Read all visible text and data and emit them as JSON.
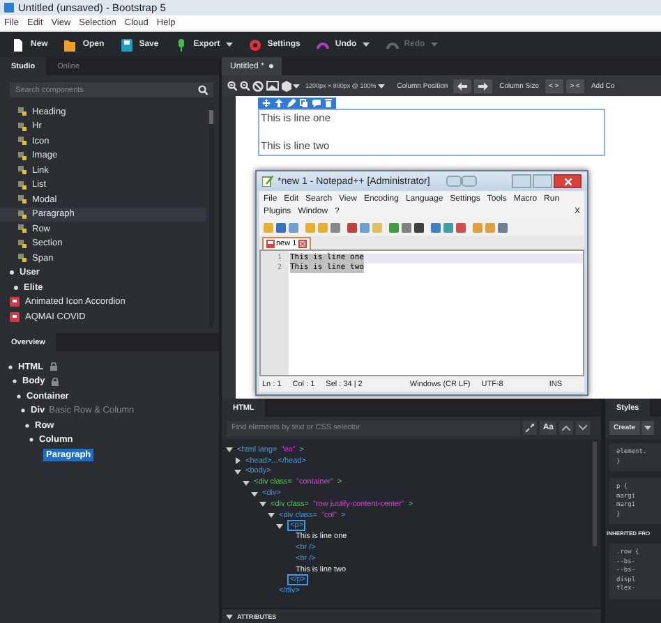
{
  "window": {
    "title": "Untitled (unsaved) - Bootstrap 5"
  },
  "menu": [
    "File",
    "Edit",
    "View",
    "Selection",
    "Cloud",
    "Help"
  ],
  "toolbar": [
    {
      "label": "New",
      "kind": "page",
      "dropdown": false,
      "disabled": false
    },
    {
      "label": "Open",
      "kind": "folder",
      "dropdown": false,
      "disabled": false
    },
    {
      "label": "Save",
      "kind": "disk",
      "dropdown": false,
      "disabled": false
    },
    {
      "label": "Export",
      "kind": "export",
      "dropdown": true,
      "disabled": false
    },
    {
      "label": "Settings",
      "kind": "gear",
      "dropdown": false,
      "disabled": false
    },
    {
      "label": "Undo",
      "kind": "undo",
      "dropdown": true,
      "disabled": false
    },
    {
      "label": "Redo",
      "kind": "redo",
      "dropdown": true,
      "disabled": true
    }
  ],
  "left_tabs": [
    {
      "label": "Studio",
      "selected": true
    },
    {
      "label": "Online",
      "selected": false
    }
  ],
  "components_search": {
    "placeholder": "Search components"
  },
  "components": [
    {
      "label": "Heading",
      "kind": "component",
      "selected": false
    },
    {
      "label": "Hr",
      "kind": "component",
      "selected": false
    },
    {
      "label": "Icon",
      "kind": "component",
      "selected": false
    },
    {
      "label": "Image",
      "kind": "component",
      "selected": false
    },
    {
      "label": "Link",
      "kind": "component",
      "selected": false
    },
    {
      "label": "List",
      "kind": "component",
      "selected": false
    },
    {
      "label": "Modal",
      "kind": "component",
      "selected": false
    },
    {
      "label": "Paragraph",
      "kind": "component",
      "selected": true
    },
    {
      "label": "Row",
      "kind": "component",
      "selected": false
    },
    {
      "label": "Section",
      "kind": "component",
      "selected": false
    },
    {
      "label": "Span",
      "kind": "component",
      "selected": false
    },
    {
      "label": "User",
      "kind": "group",
      "selected": false
    },
    {
      "label": "Elite",
      "kind": "subgroup",
      "selected": false
    },
    {
      "label": "Animated Icon Accordion",
      "kind": "package",
      "selected": false
    },
    {
      "label": "AQMAI COVID",
      "kind": "package",
      "selected": false
    }
  ],
  "overview_tab": {
    "label": "Overview",
    "selected": true
  },
  "overview_tree": [
    {
      "label": "HTML",
      "locked": true,
      "selected": false,
      "children": [
        {
          "label": "Body",
          "locked": true,
          "selected": false,
          "children": [
            {
              "label": "Container",
              "locked": false,
              "selected": false,
              "children": [
                {
                  "label": "Div",
                  "note": "Basic Row & Column",
                  "locked": false,
                  "selected": false,
                  "children": [
                    {
                      "label": "Row",
                      "locked": false,
                      "selected": false,
                      "children": [
                        {
                          "label": "Column",
                          "locked": false,
                          "selected": false,
                          "children": [
                            {
                              "label": "Paragraph",
                              "locked": false,
                              "selected": true
                            }
                          ]
                        }
                      ]
                    }
                  ]
                }
              ]
            }
          ]
        }
      ]
    }
  ],
  "doc_tab": {
    "label": "Untitled *",
    "selected": true
  },
  "canvas_toolbar": {
    "size": "1200px × 800px @ 100%",
    "column_position": "Column Position",
    "column_size": "Column Size",
    "size_buttons": [
      "< >",
      "> <"
    ],
    "add": "Add Co"
  },
  "canvas": {
    "lines": [
      "This is line one",
      "This is line two"
    ]
  },
  "notepad": {
    "title": "*new 1 - Notepad++ [Administrator]",
    "menu_rows": [
      [
        "File",
        "Edit",
        "Search",
        "View",
        "Encoding",
        "Language",
        "Settings",
        "Tools",
        "Macro",
        "Run"
      ],
      [
        "Plugins",
        "Window",
        "?"
      ]
    ],
    "close_doc": "X",
    "tab": "new 1",
    "lines": [
      {
        "number": "1",
        "text": "This is line one",
        "current": true,
        "selected": true
      },
      {
        "number": "2",
        "text": "This is line two",
        "current": false,
        "selected": true
      }
    ],
    "status": [
      "Ln : 1",
      "Col : 1",
      "Sel : 34 | 2",
      "Windows (CR LF)",
      "UTF-8",
      "INS"
    ]
  },
  "html_panel": {
    "tab": "HTML",
    "search_placeholder": "Find elements by text or CSS selector",
    "case_button": "Aa",
    "tree": [
      {
        "parts": [
          {
            "kind": "tag",
            "text": "<html lang="
          },
          {
            "kind": "value",
            "text": "\"en\""
          },
          {
            "kind": "tag",
            "text": ">"
          }
        ],
        "expanded": true,
        "selected": false,
        "children": [
          {
            "parts": [
              {
                "kind": "tag",
                "text": "<head>...</head>"
              }
            ],
            "expanded": false,
            "selected": false
          },
          {
            "parts": [
              {
                "kind": "tag",
                "text": "<body>"
              }
            ],
            "expanded": true,
            "selected": false,
            "children": [
              {
                "parts": [
                  {
                    "kind": "attr",
                    "text": "<div class="
                  },
                  {
                    "kind": "value",
                    "text": "\"container\""
                  },
                  {
                    "kind": "attr",
                    "text": ">"
                  }
                ],
                "expanded": true,
                "selected": false,
                "children": [
                  {
                    "parts": [
                      {
                        "kind": "tag",
                        "text": "<div>"
                      }
                    ],
                    "expanded": true,
                    "selected": false,
                    "children": [
                      {
                        "parts": [
                          {
                            "kind": "attr",
                            "text": "<div class="
                          },
                          {
                            "kind": "value",
                            "text": "\"row justify-content-center\""
                          },
                          {
                            "kind": "attr",
                            "text": ">"
                          }
                        ],
                        "expanded": true,
                        "selected": false,
                        "children": [
                          {
                            "parts": [
                              {
                                "kind": "tag",
                                "text": "<div class="
                              },
                              {
                                "kind": "value",
                                "text": "\"col\""
                              },
                              {
                                "kind": "tag",
                                "text": ">"
                              }
                            ],
                            "expanded": true,
                            "selected": false,
                            "close": "</div>",
                            "children": [
                              {
                                "parts": [
                                  {
                                    "kind": "tag",
                                    "text": "<p>"
                                  }
                                ],
                                "expanded": true,
                                "selected": true,
                                "close": "</p>",
                                "children": [
                                  {
                                    "parts": [
                                      {
                                        "kind": "text",
                                        "text": "This is line one"
                                      }
                                    ]
                                  },
                                  {
                                    "parts": [
                                      {
                                        "kind": "tag",
                                        "text": "<br />"
                                      }
                                    ]
                                  },
                                  {
                                    "parts": [
                                      {
                                        "kind": "tag",
                                        "text": "<br />"
                                      }
                                    ]
                                  },
                                  {
                                    "parts": [
                                      {
                                        "kind": "text",
                                        "text": "This is line two"
                                      }
                                    ]
                                  }
                                ]
                              }
                            ]
                          }
                        ]
                      }
                    ]
                  }
                ]
              }
            ]
          }
        ]
      }
    ],
    "attributes": {
      "label": "ATTRIBUTES",
      "expanded": true
    }
  },
  "styles_panel": {
    "tab": "Styles",
    "create": "Create",
    "blocks": [
      {
        "kind": "rule",
        "lines": [
          "element.",
          "}"
        ]
      },
      {
        "kind": "rule",
        "lines": [
          "p {",
          "margi",
          "margi",
          "}"
        ]
      },
      {
        "kind": "heading",
        "text": "INHERITED FRO"
      },
      {
        "kind": "rule",
        "lines": [
          ".row {",
          "--bs-",
          "--bs-",
          "displ",
          "flex-"
        ]
      }
    ]
  }
}
